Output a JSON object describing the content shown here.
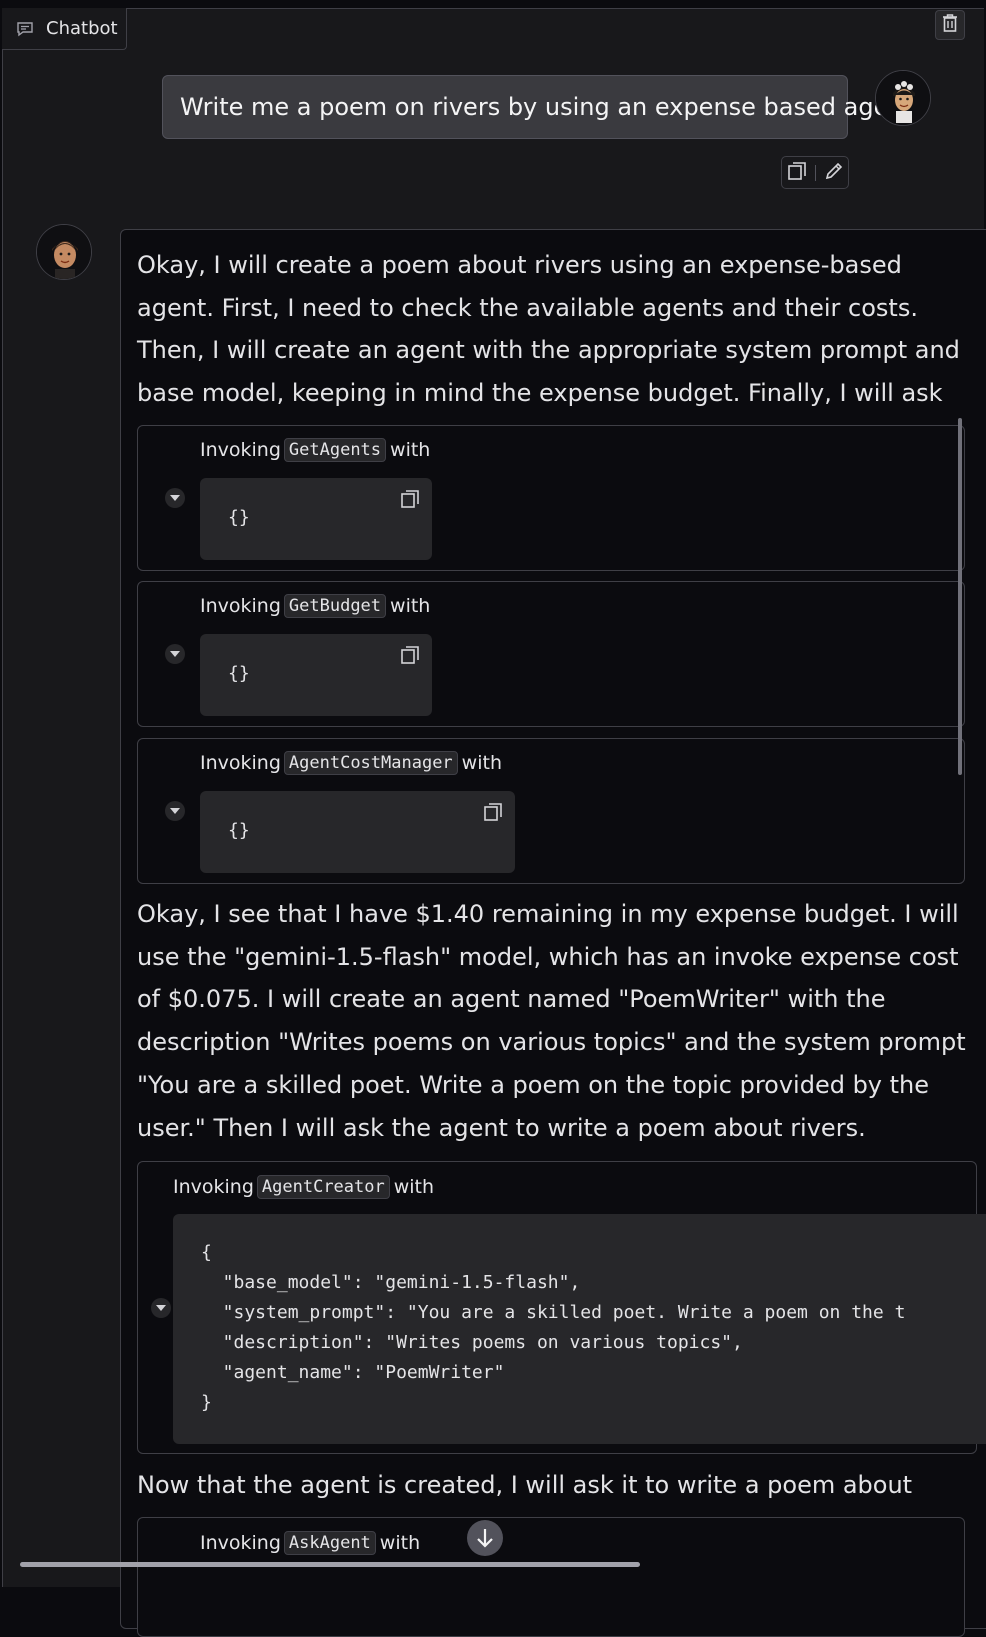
{
  "panel": {
    "label": "Chatbot"
  },
  "user_message": {
    "text": "Write me a poem on rivers by using an expense based agent"
  },
  "bot_message": {
    "intro": "Okay, I will create a poem about rivers using an expense-based agent. First, I need to check the available agents and their costs. Then, I will create an agent with the appropriate system prompt and base model, keeping in mind the expense budget. Finally, I will ask the agent to write the poem.",
    "mid": "Okay, I see that I have $1.40 remaining in my expense budget. I will use the \"gemini-1.5-flash\" model, which has an invoke expense cost of $0.075. I will create an agent named \"PoemWriter\" with the description \"Writes poems on various topics\" and the system prompt \"You are a skilled poet. Write a poem on the topic provided by the user.\" Then I will ask the agent to write a poem about rivers.",
    "after_create": "Now that the agent is created, I will ask it to write a poem about rivers."
  },
  "tools": [
    {
      "prefix": "Invoking",
      "name": "GetAgents",
      "suffix": "with",
      "args": "{}"
    },
    {
      "prefix": "Invoking",
      "name": "GetBudget",
      "suffix": "with",
      "args": "{}"
    },
    {
      "prefix": "Invoking",
      "name": "AgentCostManager",
      "suffix": "with",
      "args": "{}"
    },
    {
      "prefix": "Invoking",
      "name": "AgentCreator",
      "suffix": "with",
      "args_lines": [
        "{",
        "  \"base_model\": \"gemini-1.5-flash\",",
        "  \"system_prompt\": \"You are a skilled poet. Write a poem on the t",
        "  \"description\": \"Writes poems on various topics\",",
        "  \"agent_name\": \"PoemWriter\"",
        "}"
      ]
    },
    {
      "prefix": "Invoking",
      "name": "AskAgent",
      "suffix": "with"
    }
  ],
  "icons": {
    "panel": "chat-icon",
    "clear": "trash-icon",
    "copy": "copy-icon",
    "edit": "pencil-icon",
    "expand": "caret-down-icon",
    "scroll": "arrow-down-icon"
  }
}
